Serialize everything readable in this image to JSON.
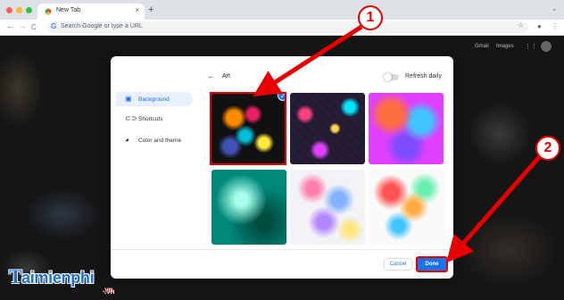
{
  "browser": {
    "tab_title": "New Tab",
    "tab_close": "×",
    "new_tab": "+",
    "address_placeholder": "Search Google or type a URL",
    "google_g": "G",
    "back": "←",
    "forward": "→",
    "reload": "C",
    "star": "☆",
    "menu": "⋮",
    "tab_menu": "⌄"
  },
  "ntp": {
    "gmail": "Gmail",
    "images": "Images",
    "apps_icon": "grid-icon"
  },
  "dialog": {
    "sidebar": [
      {
        "label": "Background",
        "icon": "image-icon",
        "active": true
      },
      {
        "label": "Shortcuts",
        "icon": "link-icon",
        "active": false
      },
      {
        "label": "Color and theme",
        "icon": "palette-icon",
        "active": false
      }
    ],
    "back_arrow": "←",
    "collection_title": "Art",
    "refresh_label": "Refresh daily",
    "refresh_on": false,
    "selected_tile": 0,
    "check_mark": "✓",
    "cancel_label": "Cancel",
    "done_label": "Done"
  },
  "annotations": {
    "callout_1": "1",
    "callout_2": "2"
  },
  "watermark": {
    "brand": "aimienphi",
    "brand_initial": "T",
    "tld": ".vn"
  },
  "colors": {
    "accent": "#1a73e8",
    "annotation_red": "#e60000",
    "brand_blue": "#1d6fd6"
  }
}
